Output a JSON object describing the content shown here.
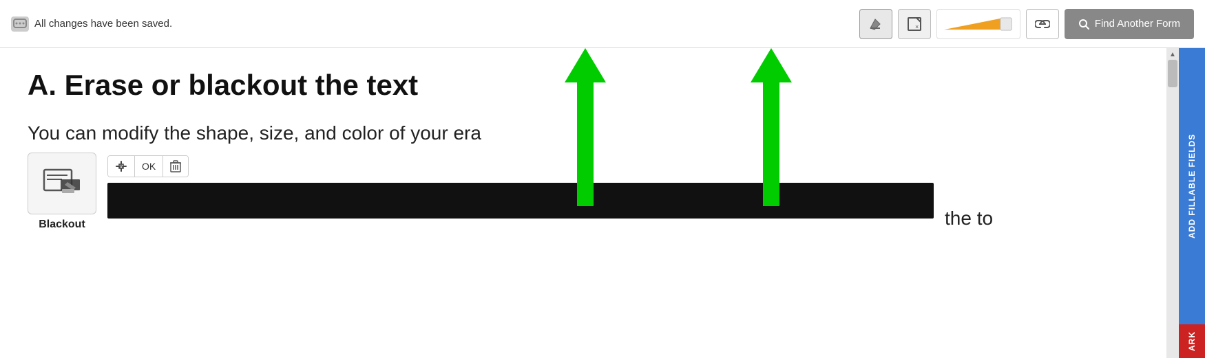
{
  "toolbar": {
    "status_text": "All changes have been saved.",
    "find_form_label": "Find Another Form",
    "erase_tool_icon": "◆",
    "crop_tool_icon": "⊡",
    "link_icon": "⛓",
    "search_icon": "🔍"
  },
  "content": {
    "title": "A. Erase or blackout the text",
    "body_text": "You can modify the shape, size, and color of your era",
    "body_text2": "the to"
  },
  "blackout_tool": {
    "label": "Blackout",
    "ok_label": "OK"
  },
  "sidebar": {
    "add_fillable_label": "ADD FILLABLE FIELDS",
    "ark_label": "ARK"
  }
}
